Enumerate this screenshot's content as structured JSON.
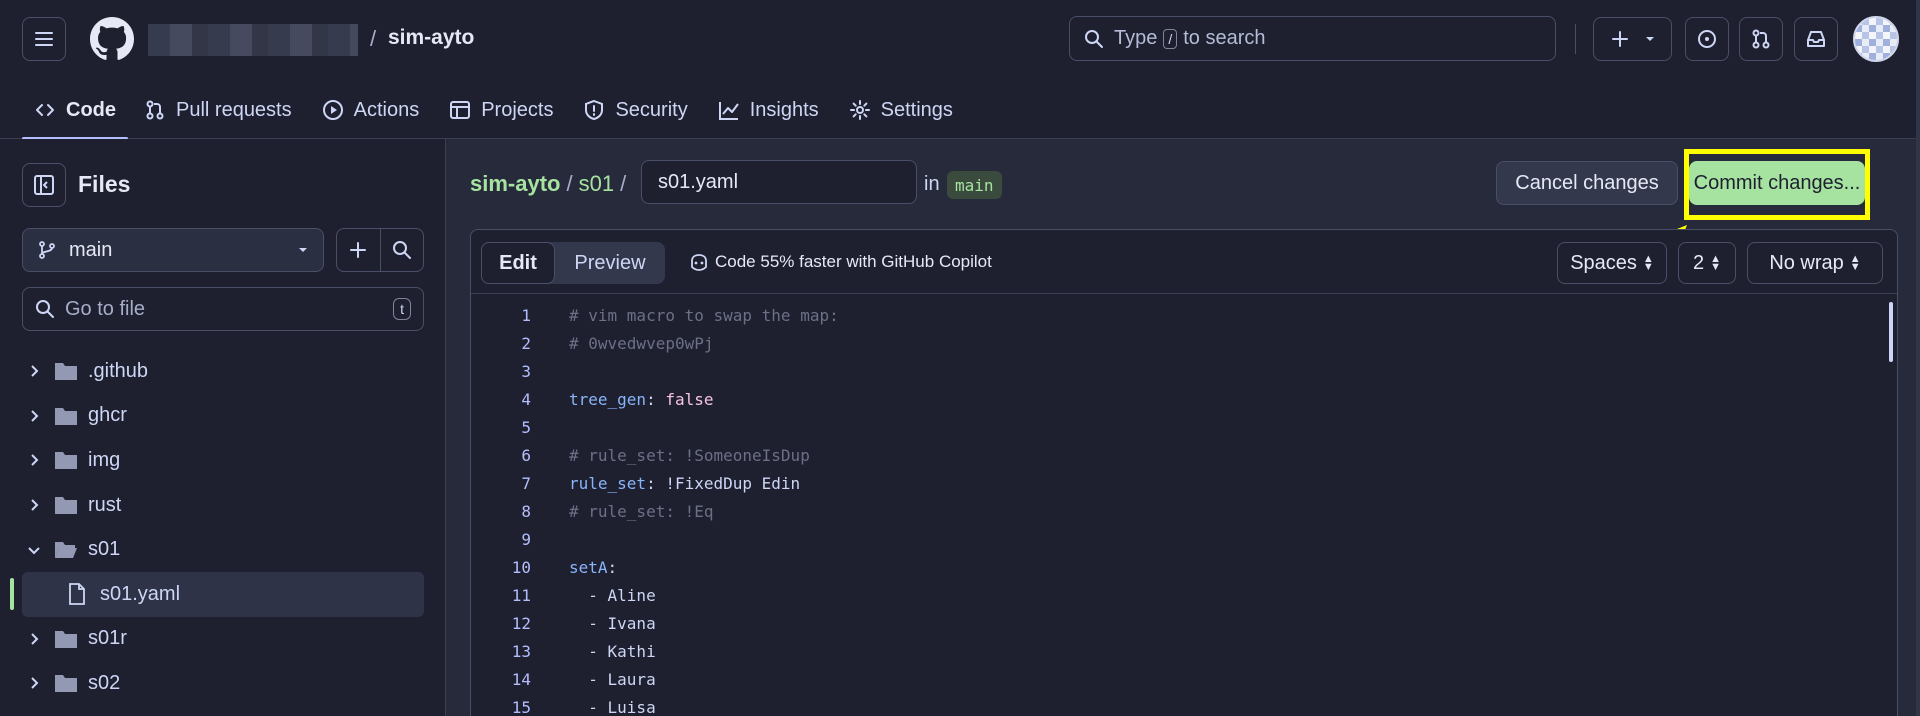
{
  "header": {
    "repo_name": "sim-ayto",
    "separator": "/",
    "search_placeholder_pre": "Type",
    "search_key": "/",
    "search_placeholder_post": "to search"
  },
  "nav_tabs": [
    {
      "label": "Code",
      "icon": "code-icon",
      "active": true
    },
    {
      "label": "Pull requests",
      "icon": "pull-request-icon"
    },
    {
      "label": "Actions",
      "icon": "play-icon"
    },
    {
      "label": "Projects",
      "icon": "table-icon"
    },
    {
      "label": "Security",
      "icon": "shield-icon"
    },
    {
      "label": "Insights",
      "icon": "graph-icon"
    },
    {
      "label": "Settings",
      "icon": "gear-icon"
    }
  ],
  "sidebar": {
    "title": "Files",
    "branch": "main",
    "goto_placeholder": "Go to file",
    "goto_key": "t",
    "tree": [
      {
        "name": ".github",
        "type": "folder",
        "expanded": false
      },
      {
        "name": "ghcr",
        "type": "folder",
        "expanded": false
      },
      {
        "name": "img",
        "type": "folder",
        "expanded": false
      },
      {
        "name": "rust",
        "type": "folder",
        "expanded": false
      },
      {
        "name": "s01",
        "type": "folder",
        "expanded": true
      },
      {
        "name": "s01.yaml",
        "type": "file",
        "selected": true
      },
      {
        "name": "s01r",
        "type": "folder",
        "expanded": false
      },
      {
        "name": "s02",
        "type": "folder",
        "expanded": false
      }
    ]
  },
  "breadcrumb": {
    "repo": "sim-ayto",
    "sep": "/",
    "dir": "s01",
    "filename": "s01.yaml",
    "in_label": "in",
    "branch": "main"
  },
  "actions": {
    "cancel_label": "Cancel changes",
    "commit_label": "Commit changes..."
  },
  "editor": {
    "tab_edit": "Edit",
    "tab_preview": "Preview",
    "copilot_text": "Code 55% faster with GitHub Copilot",
    "indent_mode": "Spaces",
    "indent_size": "2",
    "wrap_mode": "No wrap",
    "lines": [
      {
        "n": "1",
        "parts": [
          {
            "t": "# vim macro to swap the map:",
            "c": "comment"
          }
        ]
      },
      {
        "n": "2",
        "parts": [
          {
            "t": "# 0wvedwvep0wPj",
            "c": "comment"
          }
        ]
      },
      {
        "n": "3",
        "parts": []
      },
      {
        "n": "4",
        "parts": [
          {
            "t": "tree_gen",
            "c": "key"
          },
          {
            "t": ": ",
            "c": "plain"
          },
          {
            "t": "false",
            "c": "bool"
          }
        ]
      },
      {
        "n": "5",
        "parts": []
      },
      {
        "n": "6",
        "parts": [
          {
            "t": "# rule_set: !SomeoneIsDup",
            "c": "comment"
          }
        ]
      },
      {
        "n": "7",
        "parts": [
          {
            "t": "rule_set",
            "c": "key"
          },
          {
            "t": ": !FixedDup Edin",
            "c": "plain"
          }
        ]
      },
      {
        "n": "8",
        "parts": [
          {
            "t": "# rule_set: !Eq",
            "c": "comment"
          }
        ]
      },
      {
        "n": "9",
        "parts": []
      },
      {
        "n": "10",
        "parts": [
          {
            "t": "setA",
            "c": "key"
          },
          {
            "t": ":",
            "c": "plain"
          }
        ]
      },
      {
        "n": "11",
        "parts": [
          {
            "t": "  - Aline",
            "c": "plain"
          }
        ]
      },
      {
        "n": "12",
        "parts": [
          {
            "t": "  - Ivana",
            "c": "plain"
          }
        ]
      },
      {
        "n": "13",
        "parts": [
          {
            "t": "  - Kathi",
            "c": "plain"
          }
        ]
      },
      {
        "n": "14",
        "parts": [
          {
            "t": "  - Laura",
            "c": "plain"
          }
        ]
      },
      {
        "n": "15",
        "parts": [
          {
            "t": "  - Luisa",
            "c": "plain"
          }
        ]
      }
    ]
  },
  "colors": {
    "accent_green": "#a6e3a1",
    "highlight": "#ffff00",
    "background": "#262a3b"
  }
}
